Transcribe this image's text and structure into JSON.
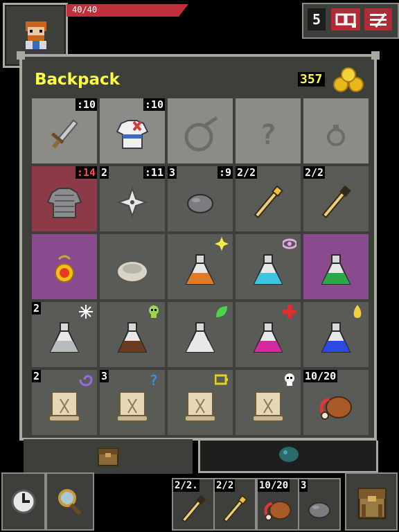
{
  "status": {
    "hp_text": "40/40",
    "hp_fraction": 1.0,
    "depth": "5",
    "journal_icon": "journal-icon",
    "menu_icon": "menu-icon",
    "hero_icon": "warrior-portrait-icon"
  },
  "backpack": {
    "title": "Backpack",
    "gold": "357",
    "gold_icon": "gold-pile-icon",
    "rows": [
      [
        {
          "name": "sword",
          "icon": "sword-icon",
          "state": "equipped",
          "tr": ":10"
        },
        {
          "name": "armor",
          "icon": "cloth-armor-icon",
          "state": "equipped",
          "tr": ":10"
        },
        {
          "name": "empty-misc-slot",
          "icon": "empty-slot-icon",
          "state": "equipped"
        },
        {
          "name": "empty-ring-slot",
          "icon": "question-slot-icon",
          "state": "equipped"
        },
        {
          "name": "empty-artifact-slot",
          "icon": "ring-slot-icon",
          "state": "equipped"
        }
      ],
      [
        {
          "name": "chainmail",
          "icon": "chainmail-icon",
          "state": "cursed",
          "tr": ":14",
          "tr_red": true
        },
        {
          "name": "shuriken",
          "icon": "shuriken-icon",
          "tl": "2",
          "tr": ":11"
        },
        {
          "name": "stone",
          "icon": "throwing-stone-icon",
          "tl": "3",
          "tr": ":9"
        },
        {
          "name": "wand-gold",
          "icon": "wand-icon",
          "tl": "2/2"
        },
        {
          "name": "wand-dark",
          "icon": "wand-icon",
          "tl": "2/2"
        }
      ],
      [
        {
          "name": "amulet",
          "icon": "amulet-icon",
          "state": "magic"
        },
        {
          "name": "stone-disc",
          "icon": "disc-icon"
        },
        {
          "name": "potion-orange",
          "icon": "potion-icon",
          "potion": "#e07a24",
          "marker": "star-marker-icon",
          "marker_color": "#f7e94a"
        },
        {
          "name": "potion-cyan",
          "icon": "potion-icon",
          "potion": "#3cc4e0",
          "marker": "eye-marker-icon",
          "marker_color": "#e8a8e8"
        },
        {
          "name": "potion-green",
          "icon": "potion-icon",
          "potion": "#2aa84a",
          "state": "magic"
        }
      ],
      [
        {
          "name": "potion-silver",
          "icon": "potion-icon",
          "potion": "#b8bcc0",
          "tl": "2",
          "marker": "frost-marker-icon",
          "marker_color": "#ffffff"
        },
        {
          "name": "potion-brown",
          "icon": "potion-icon",
          "potion": "#6a3a1e",
          "marker": "skull-marker-icon",
          "marker_color": "#9ad84a"
        },
        {
          "name": "potion-white",
          "icon": "potion-icon",
          "potion": "#e8e8e8",
          "marker": "leaf-marker-icon",
          "marker_color": "#4ad44a"
        },
        {
          "name": "potion-magenta",
          "icon": "potion-icon",
          "potion": "#d42aa0",
          "marker": "cross-marker-icon",
          "marker_color": "#e82a2a"
        },
        {
          "name": "potion-blue",
          "icon": "potion-icon",
          "potion": "#2a4ae0",
          "marker": "flame-marker-icon",
          "marker_color": "#f0d040"
        }
      ],
      [
        {
          "name": "scroll-1",
          "icon": "scroll-icon",
          "tl": "2",
          "marker": "swirl-marker-icon",
          "marker_color": "#9a6ae0"
        },
        {
          "name": "scroll-2",
          "icon": "scroll-icon",
          "tl": "3",
          "marker": "question-marker-icon",
          "marker_color": "#3a8ae8"
        },
        {
          "name": "scroll-3",
          "icon": "scroll-icon",
          "marker": "battery-marker-icon",
          "marker_color": "#e8d020"
        },
        {
          "name": "scroll-4",
          "icon": "scroll-icon",
          "marker": "skull-marker-icon",
          "marker_color": "#ffffff"
        },
        {
          "name": "meat",
          "icon": "meat-icon",
          "tl": "10/20"
        }
      ]
    ],
    "bag_tab_icon": "backpack-tab-icon",
    "pouch_tab_icon": "seed-pouch-tab-icon"
  },
  "toolbar": {
    "wait_icon": "clock-icon",
    "search_icon": "magnifier-icon",
    "quickslots": [
      {
        "name": "quickslot-wand-dark",
        "icon": "wand-icon",
        "tl": "2/2."
      },
      {
        "name": "quickslot-wand-gold",
        "icon": "wand-icon",
        "tl": "2/2"
      },
      {
        "name": "quickslot-meat",
        "icon": "meat-icon",
        "tl": "10/20"
      },
      {
        "name": "quickslot-stone",
        "icon": "throwing-stone-icon",
        "tl": "3"
      }
    ],
    "inventory_icon": "backpack-icon"
  }
}
